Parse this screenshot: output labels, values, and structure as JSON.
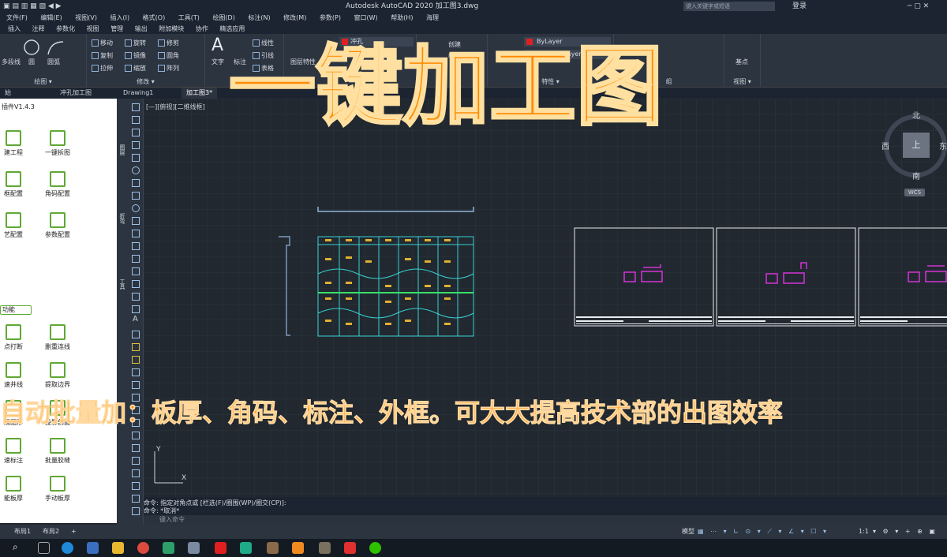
{
  "app": {
    "title": "Autodesk AutoCAD 2020    加工图3.dwg",
    "search_placeholder": "键入关键字或短语",
    "login": "登录"
  },
  "menu": [
    "文件(F)",
    "编辑(E)",
    "视图(V)",
    "插入(I)",
    "格式(O)",
    "工具(T)",
    "绘图(D)",
    "标注(N)",
    "修改(M)",
    "参数(P)",
    "窗口(W)",
    "帮助(H)",
    "海理"
  ],
  "ribbon_tabs": [
    "插入",
    "注释",
    "参数化",
    "视图",
    "管理",
    "输出",
    "附加模块",
    "协作",
    "精选应用"
  ],
  "ribbon": {
    "draw": {
      "label": "绘图 ▾",
      "tools": [
        "多段线",
        "圆",
        "圆弧"
      ]
    },
    "modify": {
      "label": "修改 ▾",
      "tools": [
        "移动",
        "旋转",
        "修剪",
        "复制",
        "镜像",
        "圆角",
        "拉伸",
        "缩放",
        "阵列"
      ]
    },
    "annotation": {
      "label": "注释 ▾",
      "tools": [
        "文字",
        "标注",
        "线性",
        "引线",
        "表格"
      ]
    },
    "layers": {
      "tools": [
        "图层特性"
      ],
      "current_layer": "冲孔"
    },
    "block": {
      "tools": [
        "插入",
        "创建",
        "编辑"
      ]
    },
    "properties": {
      "label": "特性 ▾",
      "color": "ByLayer",
      "linetype": "ByLayer"
    },
    "groups": {
      "label": "组"
    },
    "view": {
      "label": "视图 ▾",
      "tools": [
        "基点"
      ]
    }
  },
  "doc_tabs": [
    "始",
    "冲孔加工图",
    "Drawing1",
    "加工图3*"
  ],
  "plugin": {
    "version": "插件V1.4.3",
    "top_buttons": [
      "建工程",
      "一键拆图",
      "框配置",
      "角码配置",
      "艺配置",
      "参数配置"
    ],
    "section": "功能",
    "func_buttons": [
      "点打断",
      "删重连线",
      "速井线",
      "提取边界",
      "展图形",
      "投影剖面",
      "速标注",
      "批量胶缝",
      "能板厚",
      "手动板厚"
    ]
  },
  "sidebar_labels": [
    "图层",
    "折弯",
    "工具"
  ],
  "canvas": {
    "view_label": "[—][俯视][二维线框]",
    "compass": {
      "n": "北",
      "s": "南",
      "w": "西",
      "e": "东",
      "center": "上",
      "wcs": "WCS"
    },
    "axis_x": "X",
    "axis_y": "Y"
  },
  "command": {
    "line1": "命令: 指定对角点或 [栏选(F)/圈围(WP)/圈交(CP)]:",
    "line2": "命令: *取消*",
    "placeholder": "键入命令"
  },
  "layout_tabs": [
    "布局1",
    "布局2",
    "+"
  ],
  "status": {
    "model": "模型",
    "scale": "1:1"
  },
  "overlay": {
    "title": "一键加工图",
    "subtitle": "自动批量加：板厚、角码、标注、外框。可大大提高技术部的出图效率"
  },
  "colors": {
    "accent": "#ff8a00",
    "panel_green": "#5fa833",
    "drawing_cyan": "#38d1d1",
    "drawing_magenta": "#d633d6"
  }
}
